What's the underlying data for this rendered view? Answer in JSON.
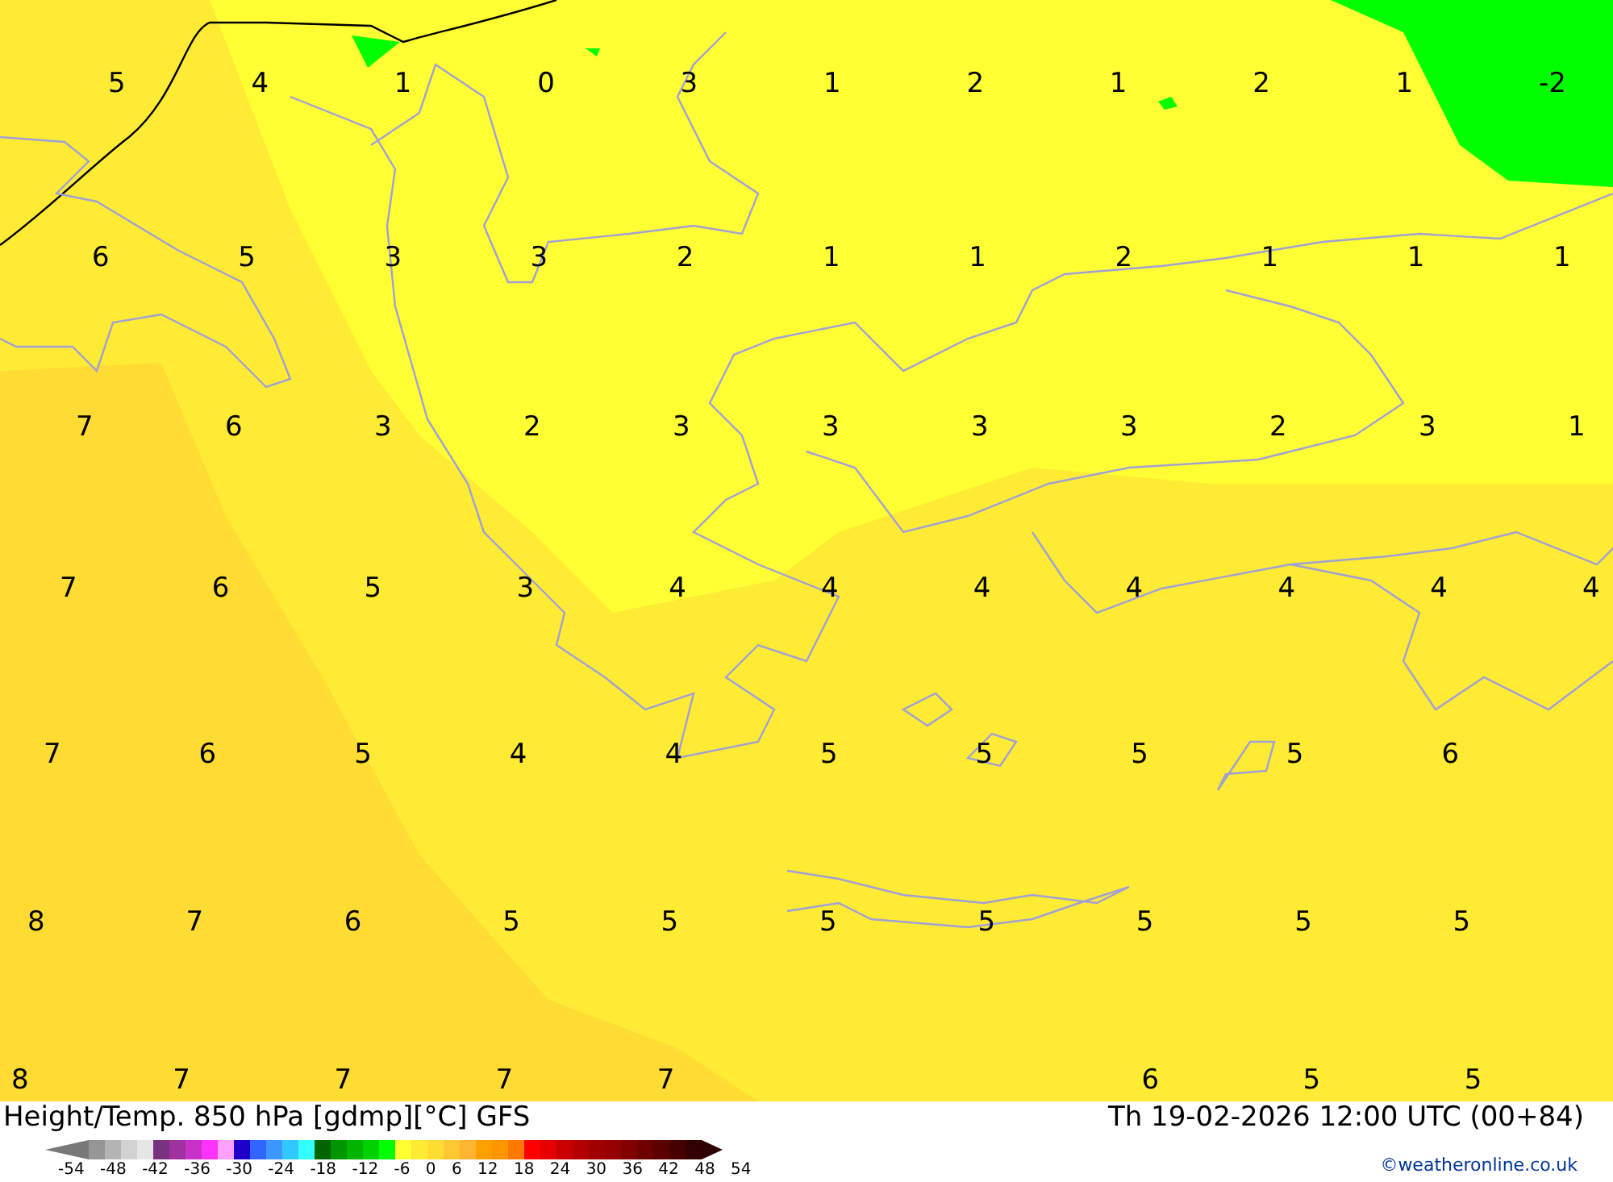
{
  "map": {
    "label_rows": [
      [
        "5",
        "4",
        "1",
        "0",
        "3",
        "1",
        "2",
        "1",
        "2",
        "1",
        "-2"
      ],
      [
        "6",
        "5",
        "3",
        "3",
        "2",
        "1",
        "1",
        "2",
        "1",
        "1",
        "1"
      ],
      [
        "7",
        "6",
        "3",
        "2",
        "3",
        "3",
        "3",
        "3",
        "2",
        "3",
        "1"
      ],
      [
        "7",
        "6",
        "5",
        "3",
        "4",
        "4",
        "4",
        "4",
        "4",
        "4",
        "4"
      ],
      [
        "7",
        "6",
        "5",
        "4",
        "4",
        "5",
        "5",
        "5",
        "5",
        "6"
      ],
      [
        "8",
        "7",
        "6",
        "5",
        "5",
        "5",
        "5",
        "5",
        "5",
        "5"
      ],
      [
        "8",
        "7",
        "7",
        "7",
        "7",
        null,
        null,
        "6",
        "5",
        "5"
      ]
    ]
  },
  "footer": {
    "title": "Height/Temp. 850 hPa [gdmp][°C] GFS",
    "datetime": "Th 19-02-2026 12:00 UTC (00+84)",
    "credit": "©weatheronline.co.uk",
    "legend": {
      "swatches": [
        {
          "color": "#969696"
        },
        {
          "color": "#b4b4b4"
        },
        {
          "color": "#d2d2d2"
        },
        {
          "color": "#e6e6e6"
        },
        {
          "color": "#783280"
        },
        {
          "color": "#a032a0"
        },
        {
          "color": "#c832c8"
        },
        {
          "color": "#ff32ff"
        },
        {
          "color": "#ffa0ff"
        },
        {
          "color": "#1e00c8"
        },
        {
          "color": "#3264ff"
        },
        {
          "color": "#3c96ff"
        },
        {
          "color": "#32c8ff"
        },
        {
          "color": "#32ffff"
        },
        {
          "color": "#006400"
        },
        {
          "color": "#009600"
        },
        {
          "color": "#00b400"
        },
        {
          "color": "#00d200"
        },
        {
          "color": "#00ff00"
        },
        {
          "color": "#ffff32"
        },
        {
          "color": "#ffeb32"
        },
        {
          "color": "#ffdc32"
        },
        {
          "color": "#ffc832"
        },
        {
          "color": "#ffb432"
        },
        {
          "color": "#ffa000"
        },
        {
          "color": "#ff9600"
        },
        {
          "color": "#ff7800"
        },
        {
          "color": "#ff0000"
        },
        {
          "color": "#e60000"
        },
        {
          "color": "#c80000"
        },
        {
          "color": "#b40000"
        },
        {
          "color": "#a00000"
        },
        {
          "color": "#960000"
        },
        {
          "color": "#820000"
        },
        {
          "color": "#6e0000"
        },
        {
          "color": "#5a0000"
        },
        {
          "color": "#460000"
        },
        {
          "color": "#320000"
        }
      ],
      "ticks": [
        "-54",
        "-48",
        "-42",
        "-36",
        "-30",
        "-24",
        "-18",
        "-12",
        "-6",
        "0",
        "6",
        "12",
        "18",
        "24",
        "30",
        "36",
        "42",
        "48",
        "54"
      ]
    }
  }
}
